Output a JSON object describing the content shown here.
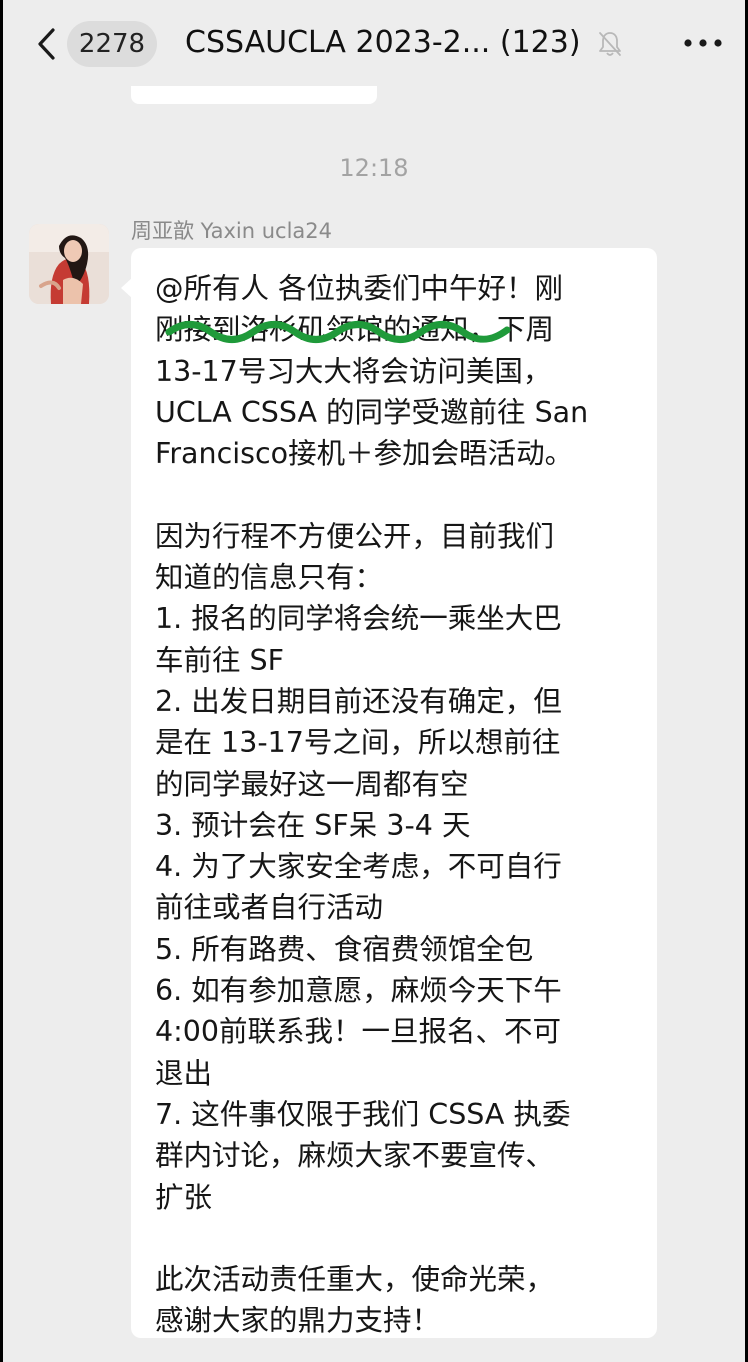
{
  "header": {
    "back_label": "back",
    "unread_count": "2278",
    "title": "CSSAUCLA 2023-2... (123)",
    "mute_icon": "bell-muted-icon",
    "more_icon": "more-dots-icon"
  },
  "chat": {
    "timestamp": "12:18",
    "message": {
      "sender": "周亚歆 Yaxin ucla24",
      "avatar_icon": "profile-photo",
      "text": "@所有人 各位执委们中午好！刚\n刚接到洛杉矶领馆的通知，下周\n13-17号习大大将会访问美国，\nUCLA CSSA 的同学受邀前往 San\nFrancisco接机＋参加会晤活动。\n\n因为行程不方便公开，目前我们\n知道的信息只有：\n1. 报名的同学将会统一乘坐大巴\n车前往 SF\n2. 出发日期目前还没有确定，但\n是在 13-17号之间，所以想前往\n的同学最好这一周都有空\n3. 预计会在 SF呆 3-4 天\n4. 为了大家安全考虑，不可自行\n前往或者自行活动\n5. 所有路费、食宿费领馆全包\n6. 如有参加意愿，麻烦今天下午\n4:00前联系我！一旦报名、不可\n退出\n7. 这件事仅限于我们 CSSA 执委\n群内讨论，麻烦大家不要宣传、\n扩张\n\n此次活动责任重大，使命光荣，\n感谢大家的鼎力支持！"
    }
  },
  "colors": {
    "background": "#ededed",
    "bubble": "#ffffff",
    "highlight_scribble": "#1f9a3a"
  }
}
